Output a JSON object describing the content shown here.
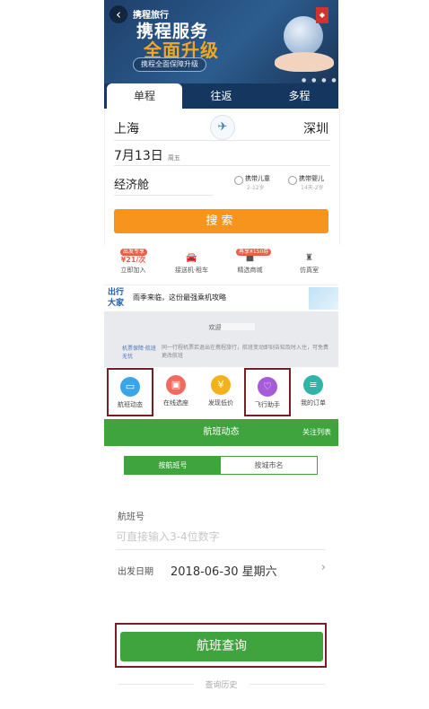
{
  "banner": {
    "brand": "携程旅行",
    "title": "携程服务",
    "highlight": "全面升级",
    "tagline": "携程全面保障升级"
  },
  "tabs": [
    "单程",
    "往返",
    "多程"
  ],
  "form": {
    "from_city": "上海",
    "to_city": "深圳",
    "date": "7月13日",
    "weekday": "周五",
    "cabin": "经济舱",
    "child_label": "携带儿童",
    "child_age": "2-12岁",
    "infant_label": "携带婴儿",
    "infant_age": "14天-2岁",
    "search_label": "搜索"
  },
  "quick_nav": [
    {
      "tag": "出发专享",
      "label": "立即加入",
      "icon_text": "¥21/次"
    },
    {
      "label": "接送机·租车",
      "icon": "car-icon"
    },
    {
      "tag": "再享¥150券",
      "label": "精选商城",
      "icon": "shop-icon"
    },
    {
      "label": "仿真室",
      "icon": "seat-icon"
    }
  ],
  "ad": {
    "logo": "出行大家",
    "text": "雨季来临，这份最强乘机攻略"
  },
  "info": {
    "welcome": "欢迎回家",
    "note": "机票保障·航班无忧",
    "desc": "同一行程机票若退出在携程旅行，航班变动即刻告知及时入住，可免费更改航班"
  },
  "services": [
    {
      "label": "航班动态",
      "icon": "flight-status-icon",
      "color": "#3aa6e8",
      "boxed": true
    },
    {
      "label": "在线选座",
      "icon": "seat-select-icon",
      "color": "#ef6b5b",
      "boxed": false
    },
    {
      "label": "发现低价",
      "icon": "low-price-icon",
      "color": "#f3b21d",
      "boxed": false
    },
    {
      "label": "飞行助手",
      "icon": "flight-assistant-icon",
      "color": "#a65cd8",
      "boxed": true
    },
    {
      "label": "我的订单",
      "icon": "orders-icon",
      "color": "#33b3a6",
      "boxed": false
    }
  ],
  "status_bar": {
    "title": "航班动态",
    "right": "关注列表"
  },
  "segment": [
    "按航班号",
    "按城市名"
  ],
  "query": {
    "flight_label": "航班号",
    "flight_placeholder": "可直接输入3-4位数字",
    "date_label": "出发日期",
    "date_value": "2018-06-30 星期六",
    "button": "航班查询",
    "history": "查询历史"
  },
  "colors": {
    "primary_green": "#3fa43d",
    "orange": "#f7941d",
    "navy": "#15375f",
    "highlight_box": "#7a1d27"
  }
}
